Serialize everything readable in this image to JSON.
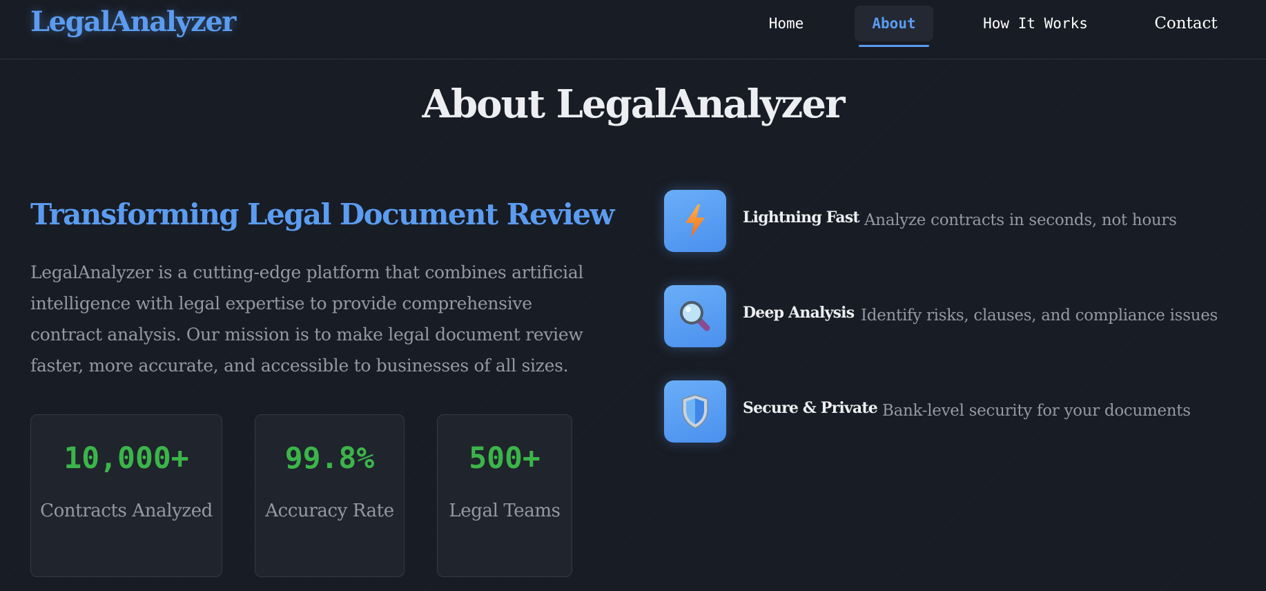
{
  "header": {
    "brand": "LegalAnalyzer",
    "nav": {
      "home": "Home",
      "about": "About",
      "how_it_works": "How It Works",
      "contact": "Contact"
    },
    "active_item": "About"
  },
  "main": {
    "page_title": "About LegalAnalyzer",
    "subtitle": "Transforming Legal Document Review",
    "description": "LegalAnalyzer is a cutting-edge platform that combines artificial intelligence with legal expertise to provide comprehensive contract analysis. Our mission is to make legal document review faster, more accurate, and accessible to businesses of all sizes.",
    "stats": [
      {
        "value": "10,000+",
        "label": "Contracts Analyzed"
      },
      {
        "value": "99.8%",
        "label": "Accuracy Rate"
      },
      {
        "value": "500+",
        "label": "Legal Teams"
      }
    ],
    "features": [
      {
        "icon": "lightning-icon",
        "title": "Lightning Fast",
        "description": "Analyze contracts in seconds, not hours"
      },
      {
        "icon": "magnifier-icon",
        "title": "Deep Analysis",
        "description": "Identify risks, clauses, and compliance issues"
      },
      {
        "icon": "shield-icon",
        "title": "Secure & Private",
        "description": "Bank-level security for your documents"
      }
    ]
  },
  "colors": {
    "background": "#181c24",
    "accent": "#5b9cf0",
    "stat_green": "#3bb54a",
    "muted_text": "#9599a1"
  }
}
